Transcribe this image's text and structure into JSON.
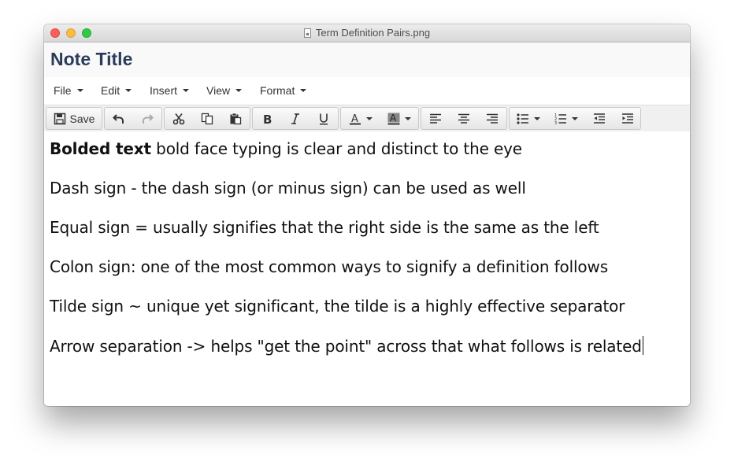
{
  "window": {
    "title": "Term Definition Pairs.png"
  },
  "note": {
    "title": "Note Title"
  },
  "menu": {
    "file": "File",
    "edit": "Edit",
    "insert": "Insert",
    "view": "View",
    "format": "Format"
  },
  "toolbar": {
    "save_label": "Save",
    "icons": [
      "save-icon",
      "undo-icon",
      "redo-icon",
      "cut-icon",
      "copy-icon",
      "paste-icon",
      "bold-icon",
      "italic-icon",
      "underline-icon",
      "text-color-icon",
      "background-color-icon",
      "align-left-icon",
      "align-center-icon",
      "align-right-icon",
      "bullet-list-icon",
      "numbered-list-icon",
      "outdent-icon",
      "indent-icon"
    ]
  },
  "content": {
    "lines": [
      {
        "bold": "Bolded text",
        "rest": " bold face typing is clear and distinct to the eye"
      },
      {
        "text": "Dash sign - the dash sign (or minus sign) can be used as well"
      },
      {
        "text": "Equal sign = usually signifies that the right side is the same as the left"
      },
      {
        "text": "Colon sign: one of the most common ways to signify a definition follows"
      },
      {
        "text": "Tilde sign ~ unique yet significant, the tilde is a highly effective separator"
      },
      {
        "text": "Arrow separation -> helps \"get the point\" across that what follows is related"
      }
    ]
  },
  "colors": {
    "title": "#2a3c5a",
    "close": "#fc605c",
    "minimize": "#fdbc40",
    "maximize": "#34c84a"
  }
}
